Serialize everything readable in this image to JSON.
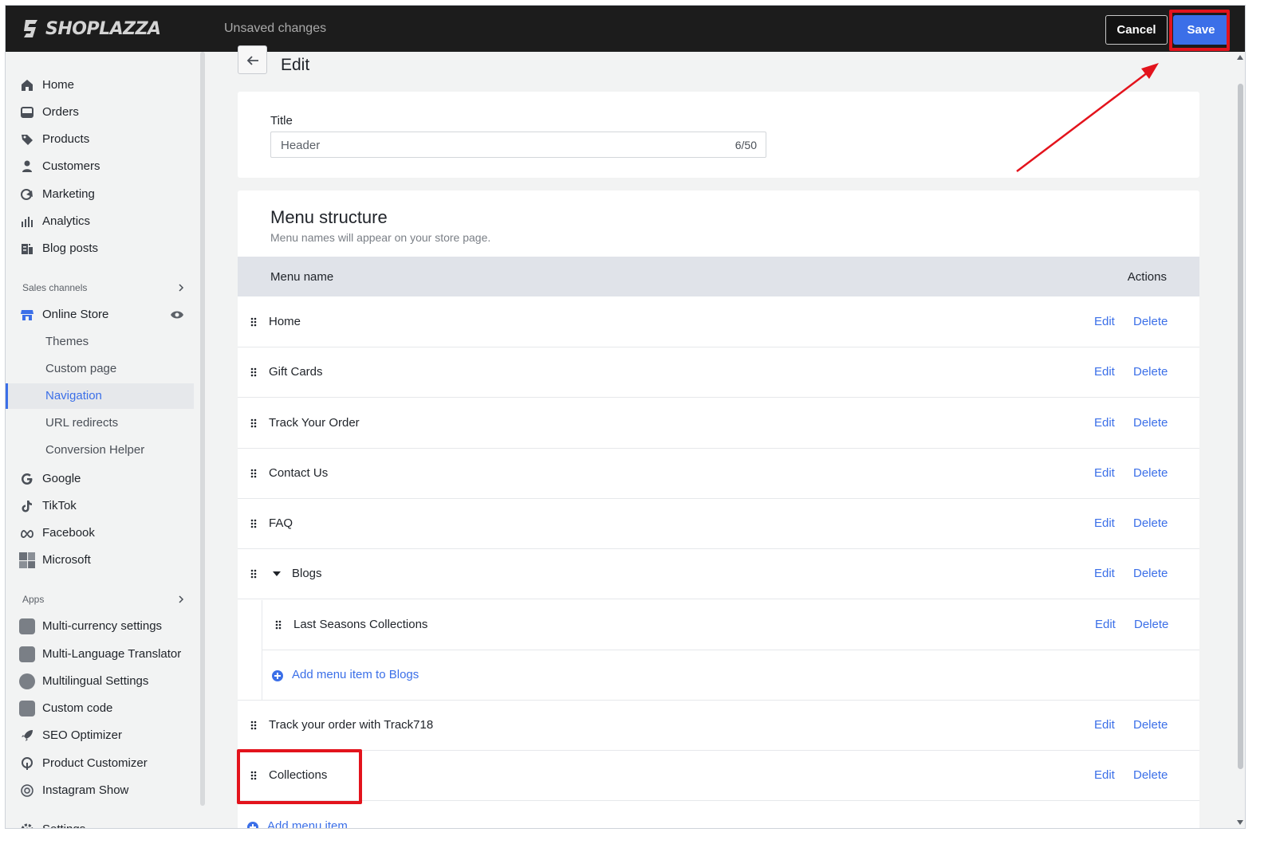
{
  "topbar": {
    "logo_text": "SHOPLAZZA",
    "status": "Unsaved changes",
    "cancel_label": "Cancel",
    "save_label": "Save"
  },
  "sidebar": {
    "items": [
      {
        "label": "Home",
        "icon": "home-icon"
      },
      {
        "label": "Orders",
        "icon": "orders-icon"
      },
      {
        "label": "Products",
        "icon": "tag-icon"
      },
      {
        "label": "Customers",
        "icon": "person-icon"
      },
      {
        "label": "Marketing",
        "icon": "marketing-icon"
      },
      {
        "label": "Analytics",
        "icon": "bar-chart-icon"
      },
      {
        "label": "Blog posts",
        "icon": "blog-icon"
      }
    ],
    "sales_channels_label": "Sales channels",
    "online_store": {
      "label": "Online Store",
      "icon": "store-icon",
      "view_icon": "eye-icon"
    },
    "online_store_sub": [
      {
        "label": "Themes"
      },
      {
        "label": "Custom page"
      },
      {
        "label": "Navigation",
        "active": true
      },
      {
        "label": "URL redirects"
      },
      {
        "label": "Conversion Helper"
      }
    ],
    "channels": [
      {
        "label": "Google",
        "icon": "google-icon"
      },
      {
        "label": "TikTok",
        "icon": "tiktok-icon"
      },
      {
        "label": "Facebook",
        "icon": "meta-icon"
      },
      {
        "label": "Microsoft",
        "icon": "microsoft-icon"
      }
    ],
    "apps_label": "Apps",
    "apps": [
      {
        "label": "Multi-currency settings"
      },
      {
        "label": "Multi-Language Translator"
      },
      {
        "label": "Multilingual Settings"
      },
      {
        "label": "Custom code"
      },
      {
        "label": "SEO Optimizer"
      },
      {
        "label": "Product Customizer"
      },
      {
        "label": "Instagram Show"
      }
    ],
    "settings_label": "Settings"
  },
  "main": {
    "page_title": "Edit",
    "title_field": {
      "label": "Title",
      "value": "Header",
      "count": "6/50"
    },
    "menu_structure": {
      "title": "Menu structure",
      "subtitle": "Menu names will appear on your store page.",
      "col_name": "Menu name",
      "col_actions": "Actions",
      "edit_label": "Edit",
      "delete_label": "Delete",
      "rows": [
        {
          "name": "Home"
        },
        {
          "name": "Gift Cards"
        },
        {
          "name": "Track Your Order"
        },
        {
          "name": "Contact Us"
        },
        {
          "name": "FAQ"
        },
        {
          "name": "Blogs",
          "expanded": true
        },
        {
          "name": "Last Seasons Collections",
          "child": true
        },
        {
          "name": "Track your order with Track718"
        },
        {
          "name": "Collections"
        }
      ],
      "add_child_label": "Add menu item to Blogs",
      "add_item_label": "Add menu item"
    }
  },
  "colors": {
    "accent": "#3b6fe8",
    "topbar": "#1c1c1c",
    "highlight": "#e3131c"
  }
}
